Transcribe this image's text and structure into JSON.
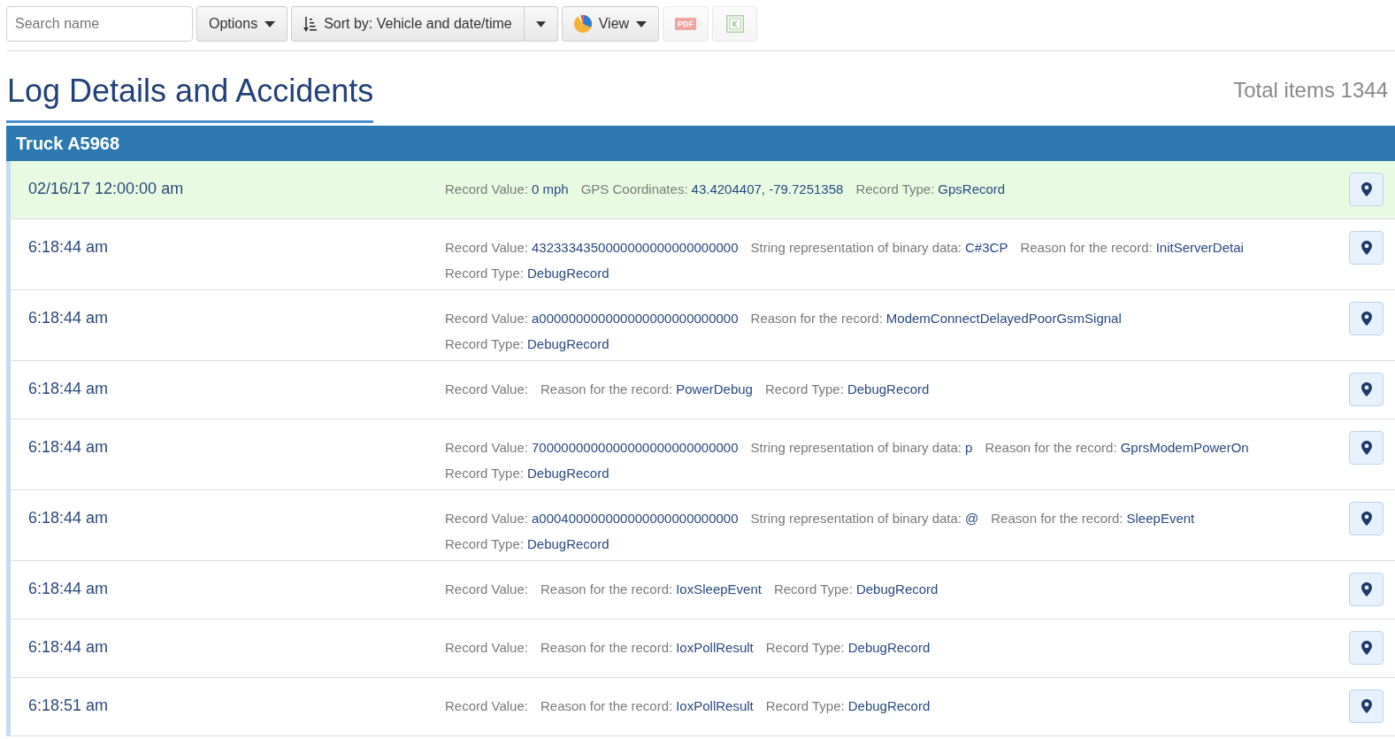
{
  "toolbar": {
    "search": {
      "placeholder": "Search name"
    },
    "options_button": {
      "label": "Options"
    },
    "sort_button": {
      "label": "Sort by: Vehicle and date/time"
    },
    "view_button": {
      "label": "View"
    },
    "export_buttons": [
      {
        "kind": "pdf",
        "label": "PDF",
        "disabled": true
      },
      {
        "kind": "excel",
        "disabled": true
      }
    ]
  },
  "page_title": "Log Details and Accidents",
  "total_items": "Total items 1344",
  "groups": [
    {
      "title": "Truck A5968",
      "records": [
        {
          "time": "02/16/17 12:00:00 am",
          "highlighted": true,
          "lines": [
            [
              {
                "label": "Record Value:",
                "value": "0 mph"
              },
              {
                "label": "GPS Coordinates:",
                "value": "43.4204407, -79.7251358"
              },
              {
                "label": "Record Type:",
                "value": "GpsRecord"
              }
            ]
          ]
        },
        {
          "time": "6:18:44 am",
          "highlighted": false,
          "lines": [
            [
              {
                "label": "Record Value:",
                "value": "4323334350000000000000000000"
              },
              {
                "label": "String representation of binary data:",
                "value": "C#3CP"
              },
              {
                "label": "Reason for the record:",
                "value": "InitServerDetai"
              }
            ],
            [
              {
                "label": "Record Type:",
                "value": "DebugRecord"
              }
            ]
          ]
        },
        {
          "time": "6:18:44 am",
          "highlighted": false,
          "lines": [
            [
              {
                "label": "Record Value:",
                "value": "a000000000000000000000000000"
              },
              {
                "label": "Reason for the record:",
                "value": "ModemConnectDelayedPoorGsmSignal"
              }
            ],
            [
              {
                "label": "Record Type:",
                "value": "DebugRecord"
              }
            ]
          ]
        },
        {
          "time": "6:18:44 am",
          "highlighted": false,
          "lines": [
            [
              {
                "label": "Record Value:"
              },
              {
                "label": "Reason for the record:",
                "value": "PowerDebug"
              },
              {
                "label": "Record Type:",
                "value": "DebugRecord"
              }
            ]
          ]
        },
        {
          "time": "6:18:44 am",
          "highlighted": false,
          "lines": [
            [
              {
                "label": "Record Value:",
                "value": "7000000000000000000000000000"
              },
              {
                "label": "String representation of binary data:",
                "value": "p"
              },
              {
                "label": "Reason for the record:",
                "value": "GprsModemPowerOn"
              }
            ],
            [
              {
                "label": "Record Type:",
                "value": "DebugRecord"
              }
            ]
          ]
        },
        {
          "time": "6:18:44 am",
          "highlighted": false,
          "lines": [
            [
              {
                "label": "Record Value:",
                "value": "a000400000000000000000000000"
              },
              {
                "label": "String representation of binary data:",
                "value": "@"
              },
              {
                "label": "Reason for the record:",
                "value": "SleepEvent"
              }
            ],
            [
              {
                "label": "Record Type:",
                "value": "DebugRecord"
              }
            ]
          ]
        },
        {
          "time": "6:18:44 am",
          "highlighted": false,
          "lines": [
            [
              {
                "label": "Record Value:"
              },
              {
                "label": "Reason for the record:",
                "value": "IoxSleepEvent"
              },
              {
                "label": "Record Type:",
                "value": "DebugRecord"
              }
            ]
          ]
        },
        {
          "time": "6:18:44 am",
          "highlighted": false,
          "lines": [
            [
              {
                "label": "Record Value:"
              },
              {
                "label": "Reason for the record:",
                "value": "IoxPollResult"
              },
              {
                "label": "Record Type:",
                "value": "DebugRecord"
              }
            ]
          ]
        },
        {
          "time": "6:18:51 am",
          "highlighted": false,
          "lines": [
            [
              {
                "label": "Record Value:"
              },
              {
                "label": "Reason for the record:",
                "value": "IoxPollResult"
              },
              {
                "label": "Record Type:",
                "value": "DebugRecord"
              }
            ]
          ]
        }
      ]
    }
  ]
}
